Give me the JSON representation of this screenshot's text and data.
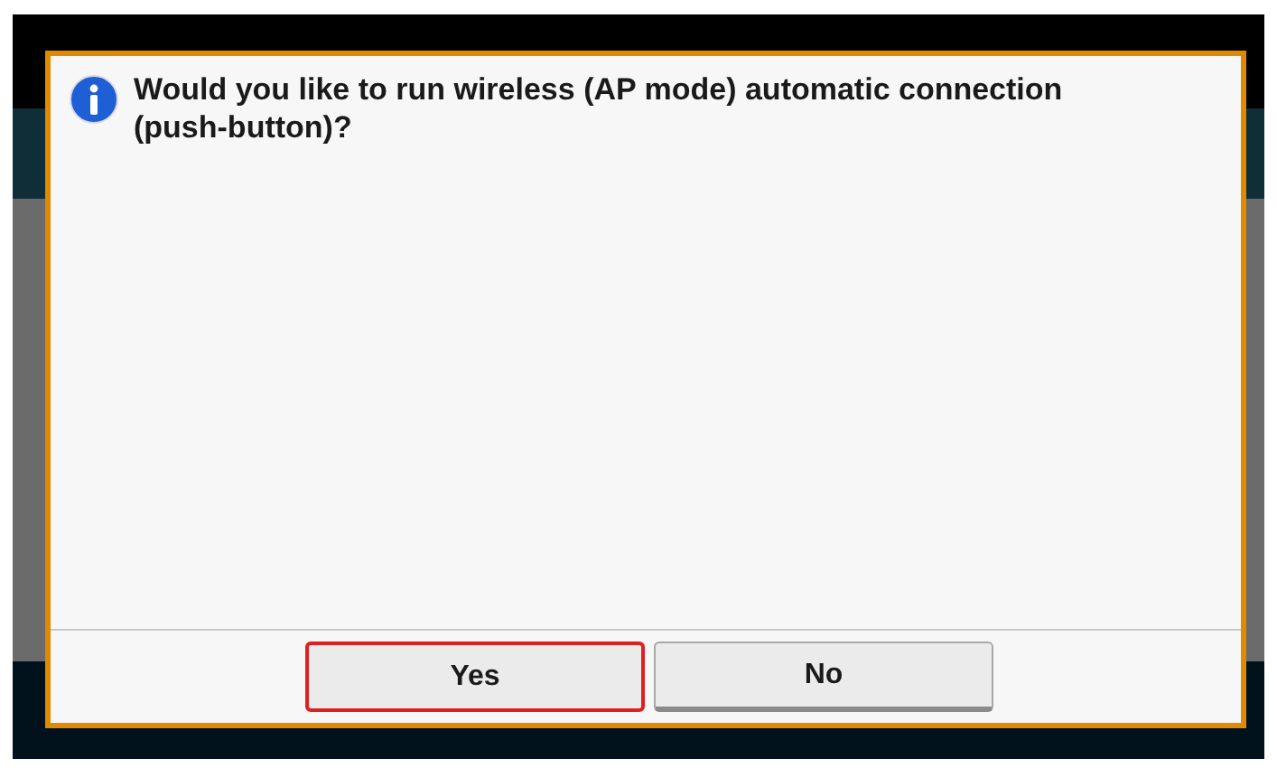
{
  "dialog": {
    "message": "Would you like to run wireless (AP mode) automatic connection (push-button)?",
    "buttons": [
      {
        "label": "Yes",
        "selected": true
      },
      {
        "label": "No",
        "selected": false
      }
    ]
  }
}
